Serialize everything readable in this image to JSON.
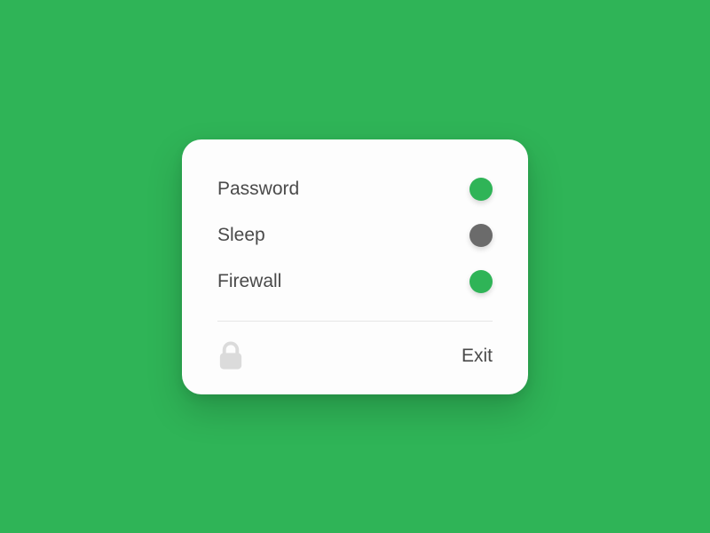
{
  "settings": {
    "items": [
      {
        "label": "Password",
        "state": "on"
      },
      {
        "label": "Sleep",
        "state": "off"
      },
      {
        "label": "Firewall",
        "state": "on"
      }
    ]
  },
  "footer": {
    "exit_label": "Exit"
  },
  "colors": {
    "accent": "#2fb457",
    "inactive": "#6b6b6b"
  }
}
